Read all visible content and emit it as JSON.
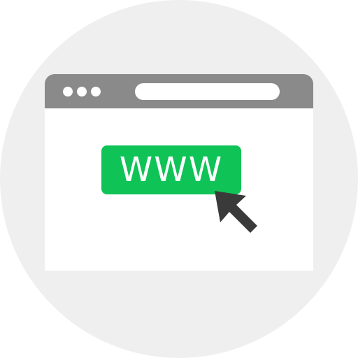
{
  "button": {
    "label": "WWW",
    "color": "#0fc356",
    "text_color": "#ffffff"
  },
  "icons": {
    "cursor": "mouse-pointer-icon",
    "window_controls": "window-dots-icon"
  },
  "colors": {
    "background_circle": "#efefef",
    "title_bar": "#8a8a8a",
    "window": "#ffffff",
    "cursor": "#3a3a3a"
  }
}
